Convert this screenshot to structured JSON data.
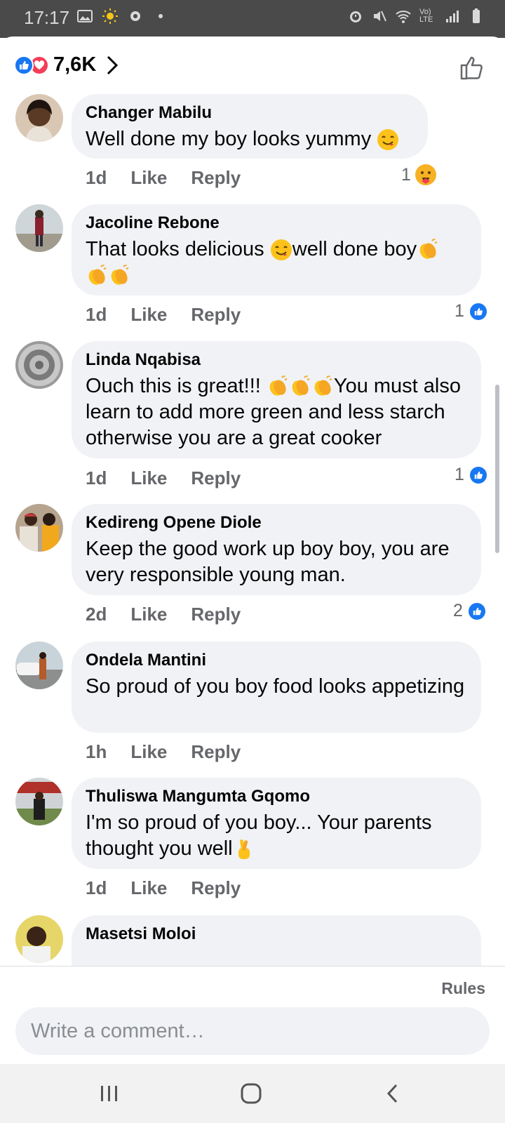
{
  "status_bar": {
    "time": "17:17",
    "network": "Vo) LTE"
  },
  "reactions": {
    "count": "7,6K"
  },
  "comments": [
    {
      "author": "Changer Mabilu",
      "text": "Well done my boy looks yummy",
      "age": "1d",
      "like": "Like",
      "reply": "Reply",
      "reaction_count": "1",
      "reaction_type": "care"
    },
    {
      "author": "Jacoline Rebone",
      "text_a": "That looks delicious ",
      "text_b": "well done boy",
      "age": "1d",
      "like": "Like",
      "reply": "Reply",
      "reaction_count": "1",
      "reaction_type": "like"
    },
    {
      "author": "Linda Nqabisa",
      "text_a": "Ouch this is great!!! ",
      "text_b": "You must also learn to add more green and less starch otherwise you are a great cooker",
      "age": "1d",
      "like": "Like",
      "reply": "Reply",
      "reaction_count": "1",
      "reaction_type": "like"
    },
    {
      "author": "Kedireng Opene Diole",
      "text": "Keep the good work up boy boy, you are very responsible young man.",
      "age": "2d",
      "like": "Like",
      "reply": "Reply",
      "reaction_count": "2",
      "reaction_type": "like"
    },
    {
      "author": "Ondela Mantini",
      "text": "So proud of you boy food looks appetizing",
      "age": "1h",
      "like": "Like",
      "reply": "Reply"
    },
    {
      "author": "Thuliswa Mangumta Gqomo",
      "text": "I'm so proud of you boy... Your parents thought you well",
      "age": "1d",
      "like": "Like",
      "reply": "Reply"
    },
    {
      "author": "Masetsi Moloi"
    }
  ],
  "composer": {
    "rules": "Rules",
    "placeholder": "Write a comment…"
  },
  "colors": {
    "accent": "#1877f2",
    "love": "#f33e58",
    "bubble": "#f0f2f5",
    "muted": "#65676b"
  },
  "icons": [
    "image-icon",
    "brightness-icon",
    "settings-icon",
    "alarm-icon",
    "mute-icon",
    "wifi-icon",
    "signal-icon",
    "battery-icon",
    "like-reaction-icon",
    "love-reaction-icon",
    "chevron-right-icon",
    "thumbs-up-icon",
    "care-reaction-icon",
    "yum-emoji-icon",
    "clap-emoji-icon",
    "crossed-fingers-emoji-icon",
    "recents-icon",
    "home-icon",
    "back-icon"
  ]
}
